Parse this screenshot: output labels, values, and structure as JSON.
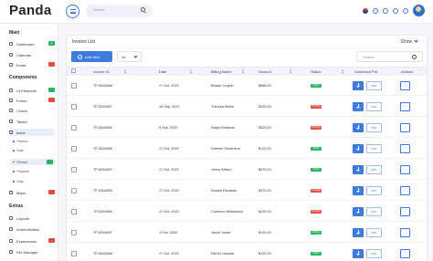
{
  "header": {
    "logo": "Panda",
    "search_placeholder": "Search"
  },
  "sidebar": {
    "sections": [
      {
        "title": "Main"
      },
      {
        "title": "Components"
      },
      {
        "title": "Extras"
      }
    ],
    "main_items": [
      {
        "label": "Dashboard",
        "badge": "5",
        "badge_color": "#28b463"
      },
      {
        "label": "Calendar"
      },
      {
        "label": "Email",
        "badge": "",
        "badge_color": "#e74c3c"
      }
    ],
    "component_items": [
      {
        "label": "UI Elements",
        "badge": "",
        "badge_color": "#28b463"
      },
      {
        "label": "Forms",
        "badge": "",
        "badge_color": "#e74c3c"
      },
      {
        "label": "Charts"
      },
      {
        "label": "Tables"
      },
      {
        "label": "Icons"
      }
    ],
    "icons_subitems": [
      {
        "label": "Preview"
      },
      {
        "label": "Data"
      },
      {
        "label": "Finance",
        "badge": "",
        "badge_color": "#28b463"
      },
      {
        "label": "Proposal"
      },
      {
        "label": "Data"
      }
    ],
    "maps_item": {
      "label": "Maps",
      "badge": "",
      "badge_color": "#e74c3c"
    },
    "extra_items": [
      {
        "label": "Layouts"
      },
      {
        "label": "Authentication"
      },
      {
        "label": "Experiences",
        "badge": "",
        "badge_color": "#e74c3c"
      },
      {
        "label": "File Manager"
      }
    ]
  },
  "invoice": {
    "title": "Invoice List",
    "show_label": "Show",
    "add_button": "Add New",
    "filter_value": "All",
    "search_placeholder": "Search",
    "columns": [
      "Invoice ID",
      "Date",
      "Billing Name",
      "Amount",
      "Status",
      "Download Pdf",
      "Actions"
    ],
    "pdf_label": "PDF",
    "action_label": "...",
    "rows": [
      {
        "id": "TP-8394838",
        "date": "17 Oct, 2020",
        "name": "Bessie Cooper",
        "amount": "$586.00",
        "status": "Active",
        "status_color": "#28b463"
      },
      {
        "id": "TP-8394837",
        "date": "18 Sep, 2020",
        "name": "Theresa Webb",
        "amount": "$325.00",
        "status": "Pending",
        "status_color": "#e74c3c"
      },
      {
        "id": "TP-8394831",
        "date": "8 Sep, 2020",
        "name": "Ralph Edwards",
        "amount": "$325.00",
        "status": "Pending",
        "status_color": "#e74c3c"
      },
      {
        "id": "TP-8394836",
        "date": "17 Oct, 2020",
        "name": "Darlene Robertson",
        "amount": "$120.00",
        "status": "Active",
        "status_color": "#28b463"
      },
      {
        "id": "TP-8394837",
        "date": "17 Oct, 2020",
        "name": "Jenny Wilson",
        "amount": "$575.00",
        "status": "Active",
        "status_color": "#28b463"
      },
      {
        "id": "TP-8394833",
        "date": "17 Oct, 2020",
        "name": "Ronald Richards",
        "amount": "$575.00",
        "status": "Pending",
        "status_color": "#e74c3c"
      },
      {
        "id": "TP-8394836",
        "date": "17 Oct, 2020",
        "name": "Cameron Williamson",
        "amount": "$249.00",
        "status": "Pending",
        "status_color": "#e74c3c"
      },
      {
        "id": "TP-8394837",
        "date": "1 Feb, 2020",
        "name": "Jacob Jones",
        "amount": "$125.00",
        "status": "Active",
        "status_color": "#28b463"
      },
      {
        "id": "TP-8394838",
        "date": "17 Oct, 2020",
        "name": "Esther Howard",
        "amount": "$125.00",
        "status": "Active",
        "status_color": "#28b463"
      }
    ]
  },
  "colors": {
    "accent": "#3d7be0",
    "active": "#28b463",
    "pending": "#e74c3c"
  }
}
